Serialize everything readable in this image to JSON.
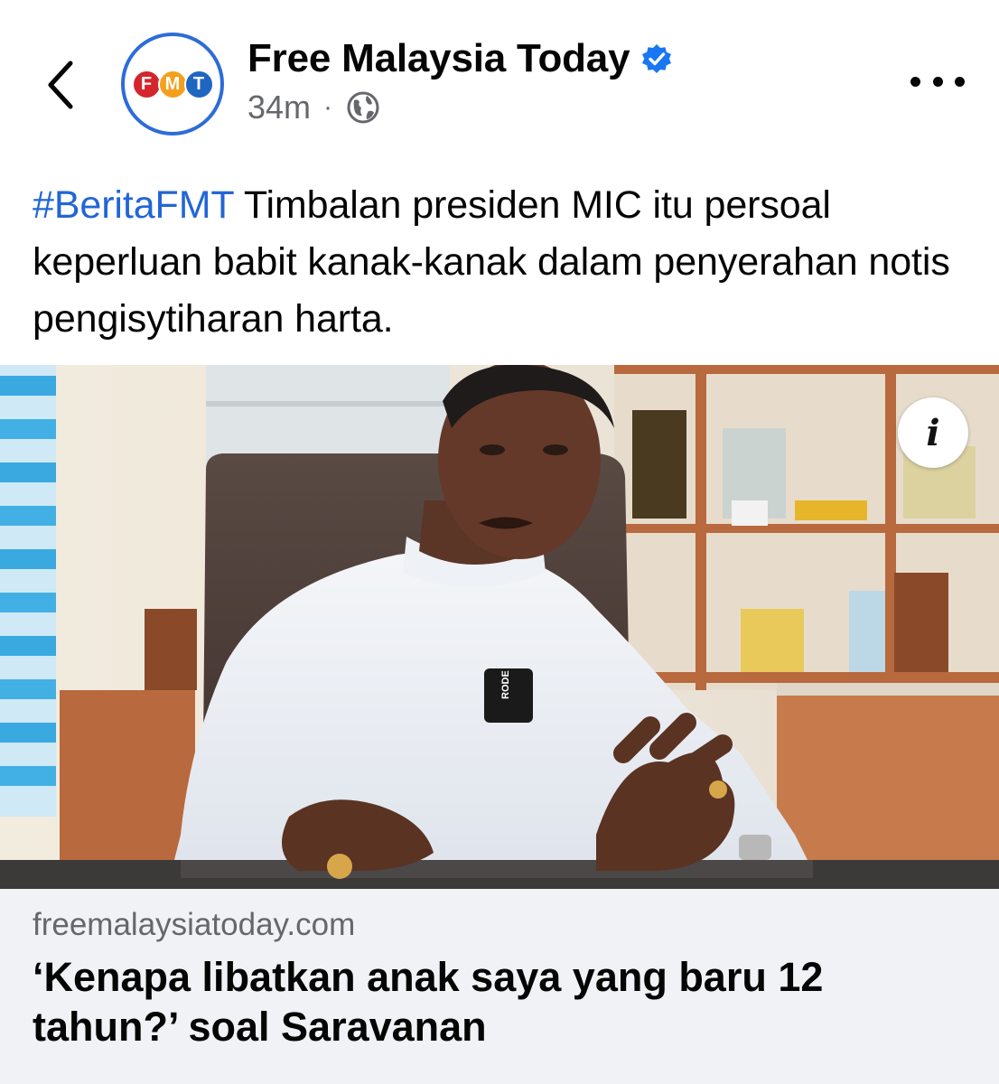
{
  "header": {
    "back_icon": "chevron-left-icon",
    "avatar": {
      "logo_letters": [
        "F",
        "M",
        "T"
      ],
      "logo_colors": [
        "#d4252c",
        "#f4a01e",
        "#1f66c1"
      ],
      "ring_color": "#2d6cd8"
    },
    "page_name": "Free Malaysia Today",
    "verified_icon": "verified-badge-icon",
    "verified_color": "#1877f2",
    "timestamp": "34m",
    "separator": "·",
    "audience_icon": "globe-icon",
    "more_icon": "more-horizontal-icon"
  },
  "post": {
    "hashtag": "#BeritaFMT",
    "text": " Timbalan presiden MIC itu persoal keperluan babit kanak-kanak dalam penyerahan notis pengisytiharan harta.",
    "hashtag_color": "#2266d4"
  },
  "photo": {
    "info_icon": "info-icon",
    "mic_label": "RODE"
  },
  "link_card": {
    "domain": "freemalaysiatoday.com",
    "title": "‘Kenapa libatkan anak saya yang baru 12 tahun?’ soal Saravanan",
    "background": "#f0f2f5"
  }
}
